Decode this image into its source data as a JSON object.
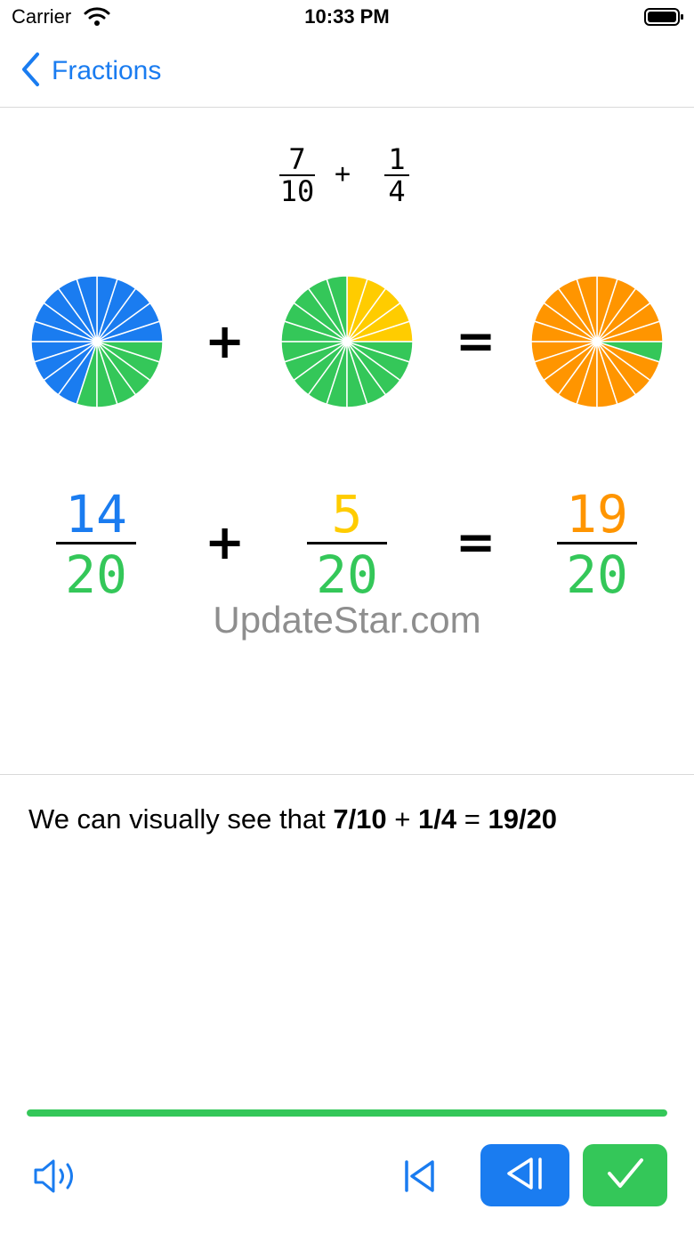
{
  "status_bar": {
    "carrier": "Carrier",
    "time": "10:33 PM"
  },
  "nav": {
    "back_label": "Fractions"
  },
  "problem": {
    "first": {
      "numerator": "7",
      "denominator": "10"
    },
    "operator": "+",
    "second": {
      "numerator": "1",
      "denominator": "4"
    }
  },
  "pies": {
    "slices": 20,
    "first": {
      "filled": 14,
      "fill_color": "#1a7cf0",
      "rest_color": "#34c759"
    },
    "second": {
      "filled": 5,
      "fill_color": "#ffcc00",
      "rest_color": "#34c759"
    },
    "result": {
      "filled": 19,
      "fill_color": "#ff9500",
      "rest_color": "#34c759"
    }
  },
  "equation": {
    "plus": "+",
    "equals": "=",
    "first": {
      "numerator": "14",
      "denominator": "20",
      "numerator_color": "#1a7cf0",
      "denominator_color": "#34c759"
    },
    "second": {
      "numerator": "5",
      "denominator": "20",
      "numerator_color": "#ffcc00",
      "denominator_color": "#34c759"
    },
    "result": {
      "numerator": "19",
      "denominator": "20",
      "numerator_color": "#ff9500",
      "denominator_color": "#34c759"
    }
  },
  "watermark": "UpdateStar.com",
  "explanation": {
    "prefix": "We can visually see that ",
    "expr1": "7/10",
    "plus": " + ",
    "expr2": "1/4",
    "equals": " = ",
    "result": "19/20"
  },
  "progress": {
    "fraction": 1.0
  },
  "toolbar": {
    "speaker_icon": "speaker-icon",
    "restart_icon": "skip-to-start-icon",
    "prev_icon": "step-back-icon",
    "check_icon": "checkmark-icon"
  },
  "colors": {
    "accent": "#1a7cf0",
    "success": "#34c759",
    "yellow": "#ffcc00",
    "orange": "#ff9500"
  }
}
